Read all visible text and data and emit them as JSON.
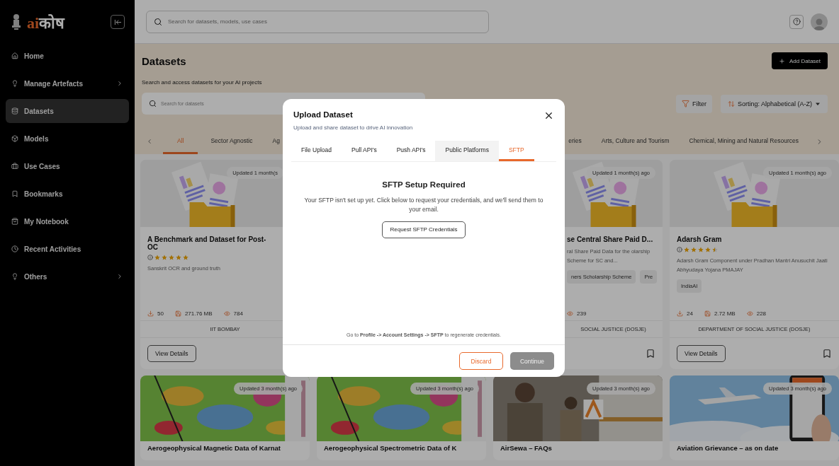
{
  "sidebar": {
    "logo": {
      "latin": "ai",
      "script": "कोष"
    },
    "items": [
      {
        "label": "Home",
        "selected": false,
        "has_submenu": false
      },
      {
        "label": "Manage Artefacts",
        "selected": false,
        "has_submenu": true
      },
      {
        "label": "Datasets",
        "selected": true,
        "has_submenu": false
      },
      {
        "label": "Models",
        "selected": false,
        "has_submenu": false
      },
      {
        "label": "Use Cases",
        "selected": false,
        "has_submenu": false
      },
      {
        "label": "Bookmarks",
        "selected": false,
        "has_submenu": false
      },
      {
        "label": "My Notebook",
        "selected": false,
        "has_submenu": false
      },
      {
        "label": "Recent Activities",
        "selected": false,
        "has_submenu": false
      },
      {
        "label": "Others",
        "selected": false,
        "has_submenu": true
      }
    ]
  },
  "top_bar": {
    "search": {
      "placeholder": "Search for datasets, models, use cases"
    }
  },
  "page": {
    "title": "Datasets",
    "subtitle": "Search and access datasets for your AI projects",
    "add_button": "Add Dataset",
    "search": {
      "placeholder": "Search for datasets"
    },
    "filter_button": "Filter",
    "sort": {
      "label": "Sorting:",
      "value": "Alphabetical (A-Z)"
    },
    "category_tabs": {
      "start": [
        {
          "label": "All",
          "selected": true
        },
        {
          "label": "Sector Agnostic",
          "selected": false
        },
        {
          "label": "Ag",
          "selected": false
        }
      ],
      "end": [
        {
          "label": "eries",
          "selected": false
        },
        {
          "label": "Arts, Culture and Tourism",
          "selected": false
        },
        {
          "label": "Chemical, Mining and Natural Resources",
          "selected": false
        }
      ]
    }
  },
  "cards": [
    {
      "kind": "cut_right",
      "badge": "Updated 1 month(s",
      "title": "A Benchmark and Dataset for Post-OC",
      "stars": 5,
      "description": "Sanskrit OCR and ground truth",
      "stats": [
        {
          "kind": "downloads",
          "value": "50"
        },
        {
          "kind": "size",
          "value": "271.76 MB"
        },
        {
          "kind": "views",
          "value": "784"
        }
      ],
      "organization": "IIT BOMBAY",
      "view_button": "View Details"
    },
    {
      "kind": "cut_left",
      "badge": "Updated 1 month(s) ago",
      "title": "se Central Share Paid D...",
      "description": "ral Share Paid Data for the olarship Scheme for SC and...",
      "tags": [
        "ners Scholarship Scheme",
        "Pre"
      ],
      "stats": [
        {
          "kind": "views",
          "value": "239"
        }
      ],
      "organization": "SOCIAL JUSTICE (DOSJE)"
    },
    {
      "kind": "full",
      "badge": "Updated 1 month(s) ago",
      "title": "Adarsh Gram",
      "stars": 4.5,
      "description": "Adarsh Gram Component under Pradhan Mantri Anusuchit Jaati Abhyudaya Yojana PMAJAY",
      "tags": [
        "IndiaAI"
      ],
      "stats": [
        {
          "kind": "downloads",
          "value": "24"
        },
        {
          "kind": "size",
          "value": "2.72 MB"
        },
        {
          "kind": "views",
          "value": "228"
        }
      ],
      "organization": "DEPARTMENT OF SOCIAL JUSTICE (DOSJE)",
      "view_button": "View Details"
    }
  ],
  "more_cards": [
    {
      "badge": "Updated 3 month(s) ago",
      "title": "Aerogeophysical Magnetic Data of Karnat"
    },
    {
      "badge": "Updated 3 month(s) ago",
      "title": "Aerogeophysical Spectrometric Data of K"
    },
    {
      "badge": "Updated 3 month(s) ago",
      "title": "AirSewa – FAQs"
    },
    {
      "badge": "Updated 3 month(s) ago",
      "title": "Aviation Grievance – as on date"
    }
  ],
  "dialog": {
    "title": "Upload Dataset",
    "subtitle": "Upload and share dataset to drive AI innovation",
    "tabs": [
      {
        "label": "File Upload",
        "selected": false,
        "hovered": false
      },
      {
        "label": "Pull API's",
        "selected": false,
        "hovered": false
      },
      {
        "label": "Push API's",
        "selected": false,
        "hovered": false
      },
      {
        "label": "Public Platforms",
        "selected": false,
        "hovered": true
      },
      {
        "label": "SFTP",
        "selected": true,
        "hovered": false
      }
    ],
    "heading": "SFTP Setup Required",
    "message": "Your SFTP isn't set up yet. Click below to request your credentials, and we'll send them to your email.",
    "request_button": "Request SFTP Credentials",
    "hint": "Go to **Profile -> Account Settings -> SFTP** to regenerate credentials.",
    "buttons": [
      {
        "label": "Discard",
        "kind": "outline",
        "disabled": false
      },
      {
        "label": "Continue",
        "kind": "primary",
        "disabled": true
      }
    ]
  }
}
